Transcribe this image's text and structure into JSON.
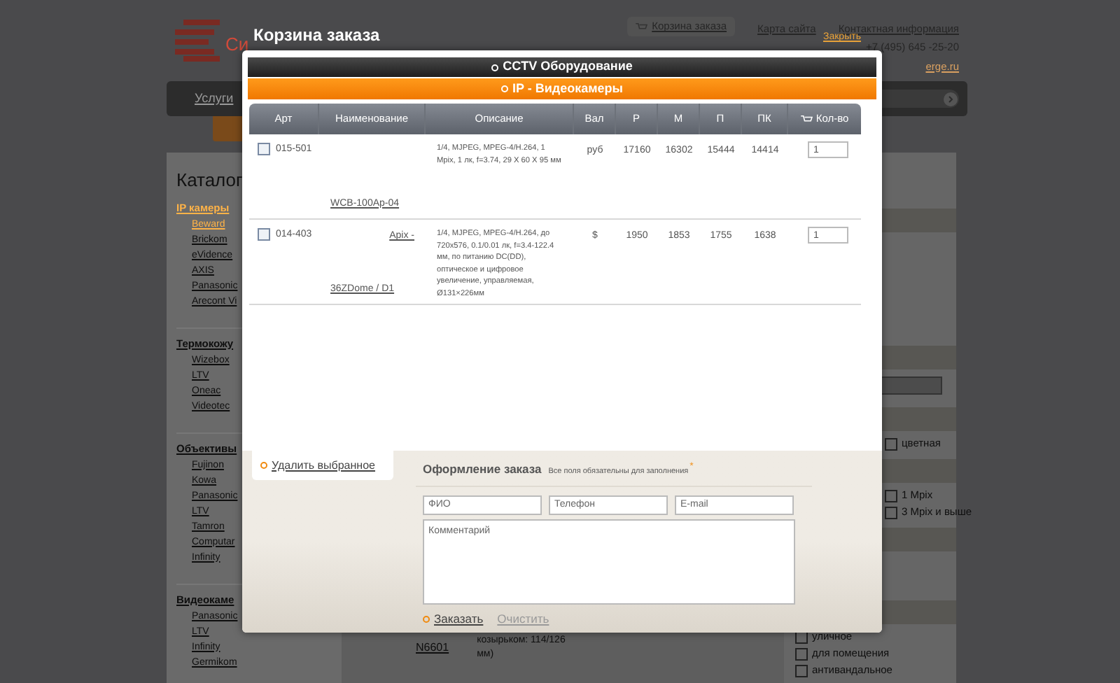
{
  "header": {
    "logo_text": "Си",
    "links": [
      {
        "label": "Корзина заказа",
        "kind": "cart"
      },
      {
        "label": "Карта сайта",
        "kind": "plain"
      },
      {
        "label": "Контактная информация",
        "kind": "plain"
      }
    ],
    "phone": "+7 (495) 645 -25-20",
    "email": "erge.ru"
  },
  "nav": {
    "items": [
      "Услуги"
    ]
  },
  "catalog": {
    "title": "Каталог",
    "groups": [
      {
        "label": "IP камеры",
        "selected": true,
        "children": [
          {
            "label": "Beward",
            "selected": true
          },
          {
            "label": "Brickom",
            "selected": false
          },
          {
            "label": "eVidence",
            "selected": false
          },
          {
            "label": "AXIS",
            "selected": false
          },
          {
            "label": "Panasonic",
            "selected": false
          },
          {
            "label": "Arecont Vi",
            "selected": false
          }
        ]
      },
      {
        "label": "Термокожу",
        "selected": false,
        "children": [
          {
            "label": "Wizebox",
            "selected": false
          },
          {
            "label": "LTV",
            "selected": false
          },
          {
            "label": "Oneac",
            "selected": false
          },
          {
            "label": "Videotec",
            "selected": false
          }
        ]
      },
      {
        "label": "Объективы",
        "selected": false,
        "children": [
          {
            "label": "Fujinon",
            "selected": false
          },
          {
            "label": "Kowa",
            "selected": false
          },
          {
            "label": "Panasonic",
            "selected": false
          },
          {
            "label": "LTV",
            "selected": false
          },
          {
            "label": "Tamron",
            "selected": false
          },
          {
            "label": "Computar",
            "selected": false
          },
          {
            "label": "Infinity",
            "selected": false
          }
        ]
      },
      {
        "label": "Видеокаме",
        "selected": false,
        "children": [
          {
            "label": "Panasonic",
            "selected": false
          },
          {
            "label": "LTV",
            "selected": false
          },
          {
            "label": "Infinity",
            "selected": false
          },
          {
            "label": "Germikom",
            "selected": false
          }
        ]
      }
    ]
  },
  "listing": {
    "name": "N6601",
    "description": "козырьком: 114/126 мм)"
  },
  "filter_groups": [
    {
      "kind": "field"
    },
    {
      "kind": "inline",
      "options": [
        {
          "label": "цветная",
          "checked": false
        }
      ]
    },
    {
      "kind": "inline",
      "options": [
        {
          "label": "1 Mpix",
          "checked": false
        },
        {
          "label": "3 Mpix и выше",
          "checked": false
        }
      ]
    },
    {
      "kind": "empty"
    },
    {
      "kind": "checkboxes",
      "options": [
        {
          "label": "уличное",
          "checked": false
        },
        {
          "label": "для помещения",
          "checked": false
        },
        {
          "label": "антивандальное",
          "checked": false
        }
      ]
    }
  ],
  "modal": {
    "title": "Корзина заказа",
    "close": "Закрыть",
    "category": "CCTV Оборудование",
    "subcategory": "IP - Видеокамеры",
    "columns": [
      "Арт",
      "Наименование",
      "Описание",
      "Вал",
      "Р",
      "М",
      "П",
      "ПК",
      "Кол-во"
    ],
    "rows": [
      {
        "checked": false,
        "article": "015-501",
        "name": [
          "WCB-100Ap-04"
        ],
        "description": "1/4, MJPEG, MPEG-4/H.264, 1 Mpix, 1 лк, f=3.74, 29 X 60 X 95 мм",
        "currency": "руб",
        "prices": [
          "17160",
          "16302",
          "15444",
          "14414"
        ],
        "quantity": "1"
      },
      {
        "checked": false,
        "article": "014-403",
        "name": [
          "Apix -",
          "36ZDome / D1"
        ],
        "description": "1/4, MJPEG, MPEG-4/H.264, до 720x576, 0.1/0.01 лк, f=3.4-122.4 мм, по питанию DC(DD), оптическое и цифровое увеличение, управляемая, Ø131×226мм",
        "currency": "$",
        "prices": [
          "1950",
          "1853",
          "1755",
          "1638"
        ],
        "quantity": "1"
      }
    ],
    "delete_selected": "Удалить выбранное",
    "order": {
      "title": "Оформление заказа",
      "note": "Все поля обязательны для заполнения",
      "required_mark": "*",
      "fields": [
        {
          "placeholder": "ФИО"
        },
        {
          "placeholder": "Телефон"
        },
        {
          "placeholder": "E-mail"
        }
      ],
      "comment": {
        "placeholder": "Комментарий"
      },
      "submit": "Заказать",
      "clear": "Очистить"
    }
  }
}
